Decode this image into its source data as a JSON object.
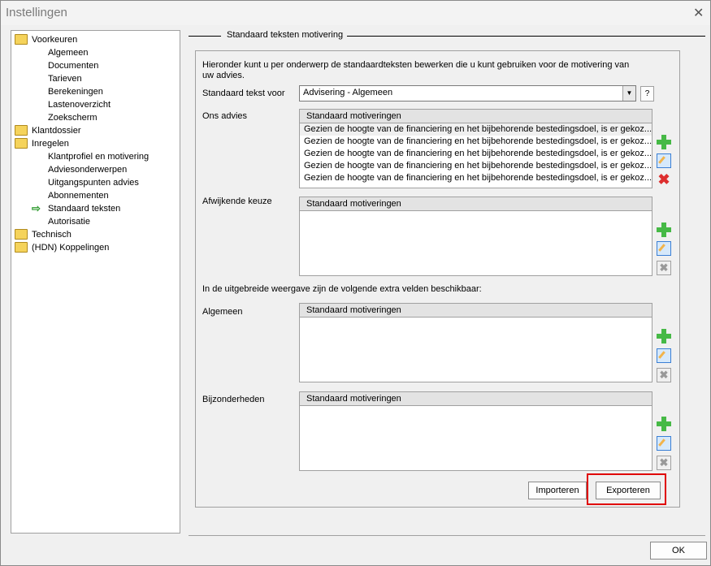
{
  "window": {
    "title": "Instellingen",
    "close_glyph": "✕"
  },
  "tree": [
    {
      "label": "Voorkeuren",
      "type": "folder"
    },
    {
      "label": "Algemeen",
      "type": "leaf"
    },
    {
      "label": "Documenten",
      "type": "leaf"
    },
    {
      "label": "Tarieven",
      "type": "leaf"
    },
    {
      "label": "Berekeningen",
      "type": "leaf"
    },
    {
      "label": "Lastenoverzicht",
      "type": "leaf"
    },
    {
      "label": "Zoekscherm",
      "type": "leaf"
    },
    {
      "label": "Klantdossier",
      "type": "folder"
    },
    {
      "label": "Inregelen",
      "type": "folder"
    },
    {
      "label": "Klantprofiel en motivering",
      "type": "leaf"
    },
    {
      "label": "Adviesonderwerpen",
      "type": "leaf"
    },
    {
      "label": "Uitgangspunten advies",
      "type": "leaf"
    },
    {
      "label": "Abonnementen",
      "type": "leaf"
    },
    {
      "label": "Standaard teksten",
      "type": "leaf",
      "selected": true
    },
    {
      "label": "Autorisatie",
      "type": "leaf"
    },
    {
      "label": "Technisch",
      "type": "folder"
    },
    {
      "label": "(HDN) Koppelingen",
      "type": "folder"
    }
  ],
  "group_title": "Standaard teksten motivering",
  "intro": "Hieronder kunt u per onderwerp de standaardteksten bewerken die u kunt gebruiken voor de motivering van uw advies.",
  "select": {
    "label": "Standaard tekst voor",
    "value": "Advisering - Algemeen",
    "help": "?"
  },
  "sections": {
    "ons_advies": {
      "label": "Ons advies",
      "header": "Standaard motiveringen",
      "rows": [
        "Gezien de hoogte van de financiering en het bijbehorende bestedingsdoel, is er gekoz...",
        "Gezien de hoogte van de financiering en het bijbehorende bestedingsdoel, is er gekoz...",
        "Gezien de hoogte van de financiering en het bijbehorende bestedingsdoel, is er gekoz...",
        "Gezien de hoogte van de financiering en het bijbehorende bestedingsdoel, is er gekoz...",
        "Gezien de hoogte van de financiering en het bijbehorende bestedingsdoel, is er gekoz..."
      ]
    },
    "afwijkende_keuze": {
      "label": "Afwijkende keuze",
      "header": "Standaard motiveringen"
    },
    "extra_info": "In de uitgebreide weergave zijn de volgende extra velden beschikbaar:",
    "algemeen": {
      "label": "Algemeen",
      "header": "Standaard motiveringen"
    },
    "bijzonderheden": {
      "label": "Bijzonderheden",
      "header": "Standaard motiveringen"
    }
  },
  "buttons": {
    "importeren": "Importeren",
    "exporteren": "Exporteren",
    "ok": "OK"
  },
  "colors": {
    "highlight": "#e00000",
    "add": "#46b946",
    "delete": "#dd2e2e"
  }
}
